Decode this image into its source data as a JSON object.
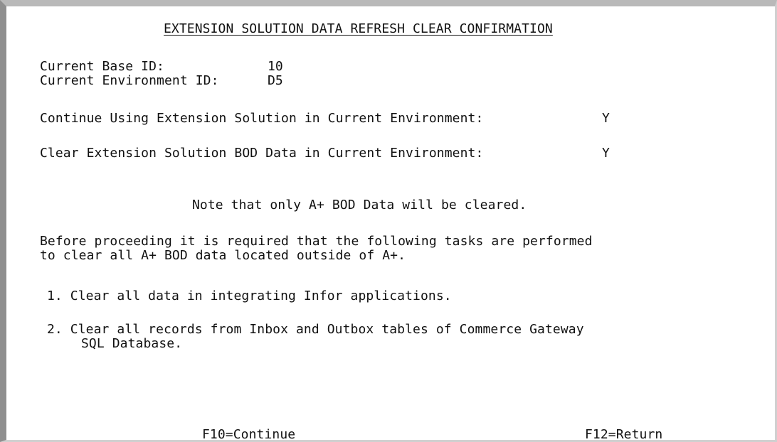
{
  "screen": {
    "title": "EXTENSION SOLUTION DATA REFRESH CLEAR CONFIRMATION",
    "base": {
      "label": "Current Base ID:",
      "value": "10"
    },
    "environment": {
      "label": "Current Environment ID:",
      "value": "D5"
    },
    "continue_using": {
      "label": "Continue Using Extension Solution in Current Environment:",
      "value": "Y"
    },
    "clear_bod": {
      "label": "Clear Extension Solution BOD Data in Current Environment:",
      "value": "Y"
    },
    "note": "Note that only A+ BOD Data will be cleared.",
    "instructions": [
      "Before proceeding it is required that the following tasks are performed",
      "to clear all A+ BOD data located outside of A+."
    ],
    "tasks": [
      {
        "line1": "1. Clear all data in integrating Infor applications.",
        "line2": ""
      },
      {
        "line1": "2. Clear all records from Inbox and Outbox tables of Commerce Gateway",
        "line2": "SQL Database."
      }
    ]
  },
  "function_keys": {
    "f10": "F10=Continue",
    "f12": "F12=Return"
  }
}
